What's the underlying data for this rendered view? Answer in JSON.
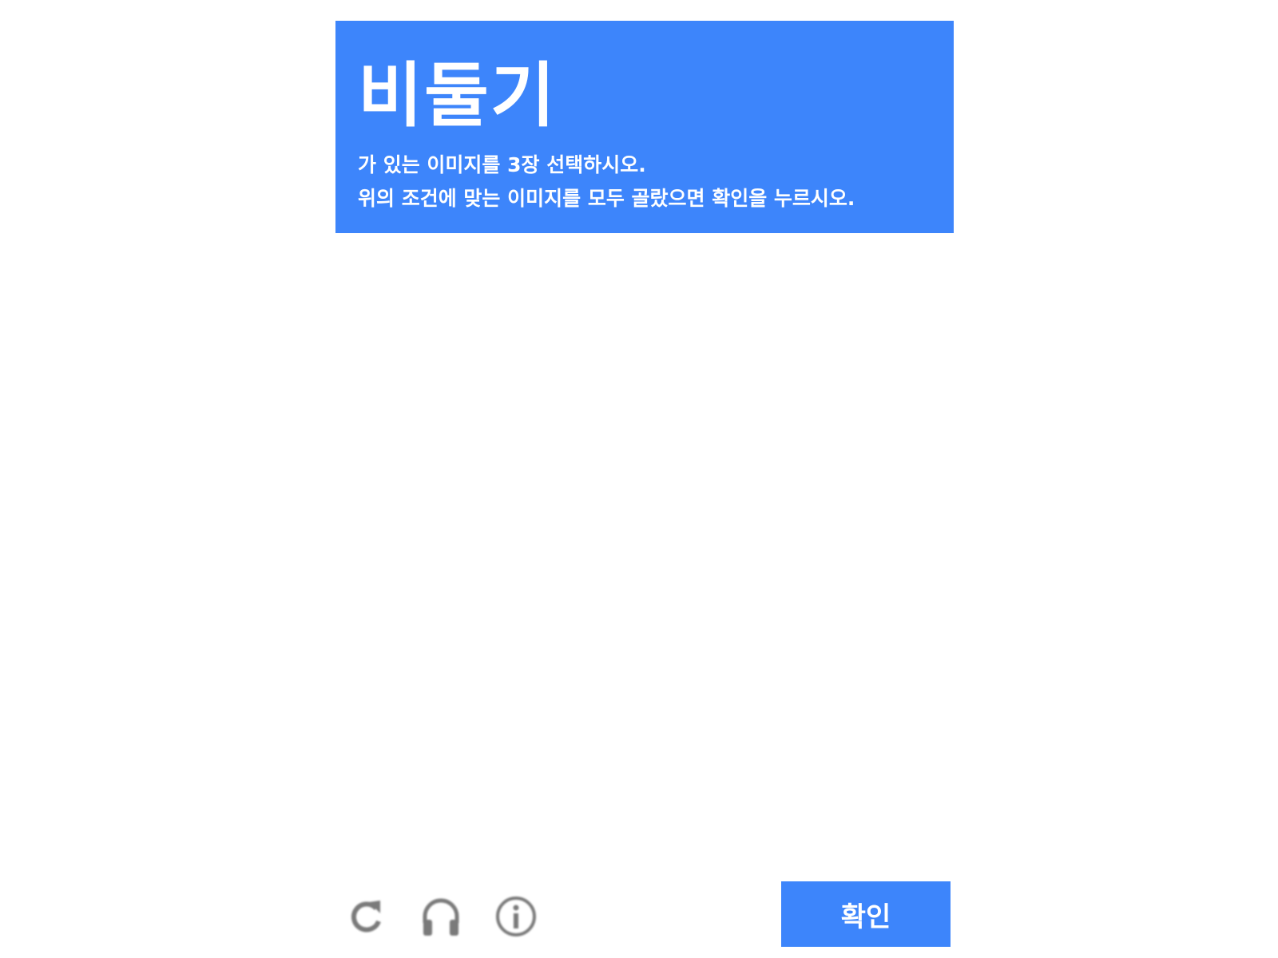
{
  "challenge": {
    "title": "비둘기",
    "instruction_line1": "가 있는 이미지를 3장 선택하시오.",
    "instruction_line2": "위의 조건에 맞는 이미지를 모두 골랐으면 확인을 누르시오."
  },
  "footer": {
    "icons": [
      "refresh-icon",
      "headphones-icon",
      "info-icon"
    ],
    "confirm_label": "확인"
  },
  "colors": {
    "accent": "#3d85fb",
    "icon": "#7a7a7a",
    "background": "#ffffff"
  }
}
